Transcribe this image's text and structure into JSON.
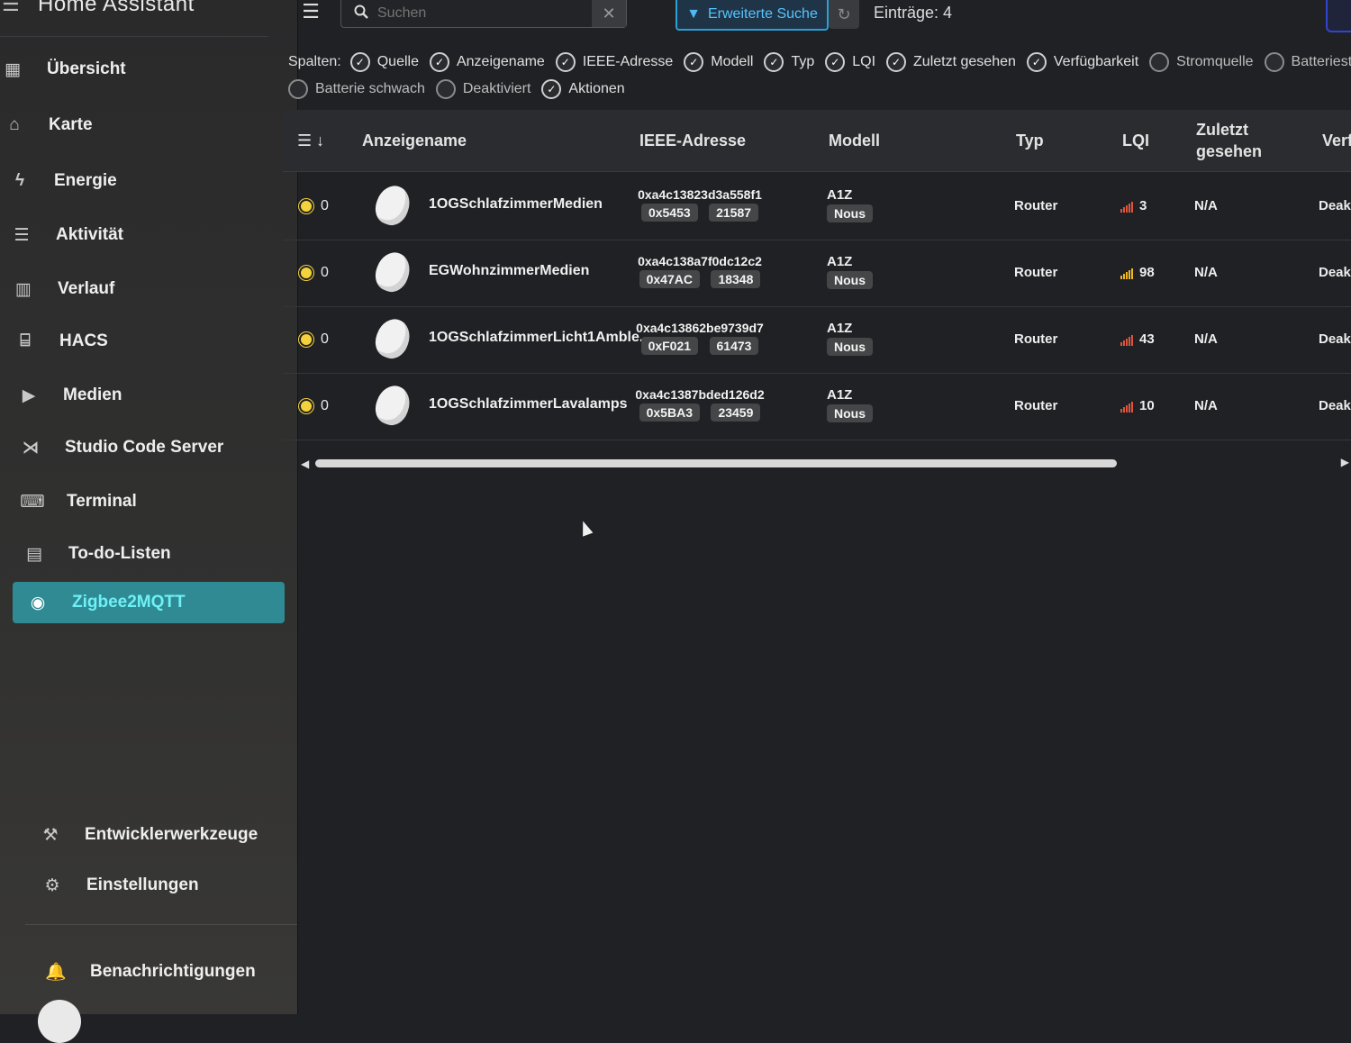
{
  "app": {
    "title": "Home Assistant"
  },
  "sidebar": {
    "items": [
      {
        "label": "Übersicht",
        "icon": "dashboard-icon"
      },
      {
        "label": "Karte",
        "icon": "map-icon"
      },
      {
        "label": "Energie",
        "icon": "lightning-icon"
      },
      {
        "label": "Aktivität",
        "icon": "list-icon"
      },
      {
        "label": "Verlauf",
        "icon": "chart-icon"
      },
      {
        "label": "HACS",
        "icon": "hacs-icon"
      },
      {
        "label": "Medien",
        "icon": "media-play-icon"
      },
      {
        "label": "Studio Code Server",
        "icon": "vscode-icon"
      },
      {
        "label": "Terminal",
        "icon": "terminal-icon"
      },
      {
        "label": "To-do-Listen",
        "icon": "clipboard-list-icon"
      },
      {
        "label": "Zigbee2MQTT",
        "icon": "zigbee-icon",
        "active": true
      }
    ],
    "bottom": [
      {
        "label": "Entwicklerwerkzeuge",
        "icon": "hammer-icon"
      },
      {
        "label": "Einstellungen",
        "icon": "gear-icon"
      },
      {
        "label": "Benachrichtigungen",
        "icon": "bell-icon"
      }
    ]
  },
  "toolbar": {
    "search_placeholder": "Suchen",
    "advanced_search_label": "Erweiterte Suche",
    "entries_label": "Einträge: 4"
  },
  "columns_filter": {
    "label": "Spalten:",
    "options": [
      {
        "label": "Quelle",
        "checked": true
      },
      {
        "label": "Anzeigename",
        "checked": true
      },
      {
        "label": "IEEE-Adresse",
        "checked": true
      },
      {
        "label": "Modell",
        "checked": true
      },
      {
        "label": "Typ",
        "checked": true
      },
      {
        "label": "LQI",
        "checked": true
      },
      {
        "label": "Zuletzt gesehen",
        "checked": true
      },
      {
        "label": "Verfügbarkeit",
        "checked": true
      },
      {
        "label": "Stromquelle",
        "checked": false
      },
      {
        "label": "Batteriestand",
        "checked": false
      },
      {
        "label": "Batterie schwach",
        "checked": false
      },
      {
        "label": "Deaktiviert",
        "checked": false
      },
      {
        "label": "Aktionen",
        "checked": true
      }
    ]
  },
  "table": {
    "headers": {
      "name": "Anzeigename",
      "ieee": "IEEE-Adresse",
      "model": "Modell",
      "type": "Typ",
      "lqi": "LQI",
      "last_seen_1": "Zuletzt",
      "last_seen_2": "gesehen",
      "availability": "Verf"
    },
    "rows": [
      {
        "status": "0",
        "name": "1OGSchlafzimmerMedien",
        "ieee": "0xa4c13823d3a558f1",
        "nwk_hex": "0x5453",
        "nwk_dec": "21587",
        "model": "A1Z",
        "vendor": "Nous",
        "type": "Router",
        "lqi": "3",
        "lqi_color": "#e0543c",
        "last_seen": "N/A",
        "availability": "Deakt"
      },
      {
        "status": "0",
        "name": "EGWohnzimmerMedien",
        "ieee": "0xa4c138a7f0dc12c2",
        "nwk_hex": "0x47AC",
        "nwk_dec": "18348",
        "model": "A1Z",
        "vendor": "Nous",
        "type": "Router",
        "lqi": "98",
        "lqi_color": "#f0b824",
        "last_seen": "N/A",
        "availability": "Deakt"
      },
      {
        "status": "0",
        "name": "1OGSchlafzimmerLicht1Amble...",
        "ieee": "0xa4c13862be9739d7",
        "nwk_hex": "0xF021",
        "nwk_dec": "61473",
        "model": "A1Z",
        "vendor": "Nous",
        "type": "Router",
        "lqi": "43",
        "lqi_color": "#e0543c",
        "last_seen": "N/A",
        "availability": "Deakti"
      },
      {
        "status": "0",
        "name": "1OGSchlafzimmerLavalamps",
        "ieee": "0xa4c1387bded126d2",
        "nwk_hex": "0x5BA3",
        "nwk_dec": "23459",
        "model": "A1Z",
        "vendor": "Nous",
        "type": "Router",
        "lqi": "10",
        "lqi_color": "#e0543c",
        "last_seen": "N/A",
        "availability": "Deaktiv"
      }
    ]
  },
  "colors": {
    "accent": "#2f8a93",
    "accent_text": "#6ff0f6",
    "advanced_search": "#56c3ff",
    "status_dot": "#f4d23c"
  }
}
